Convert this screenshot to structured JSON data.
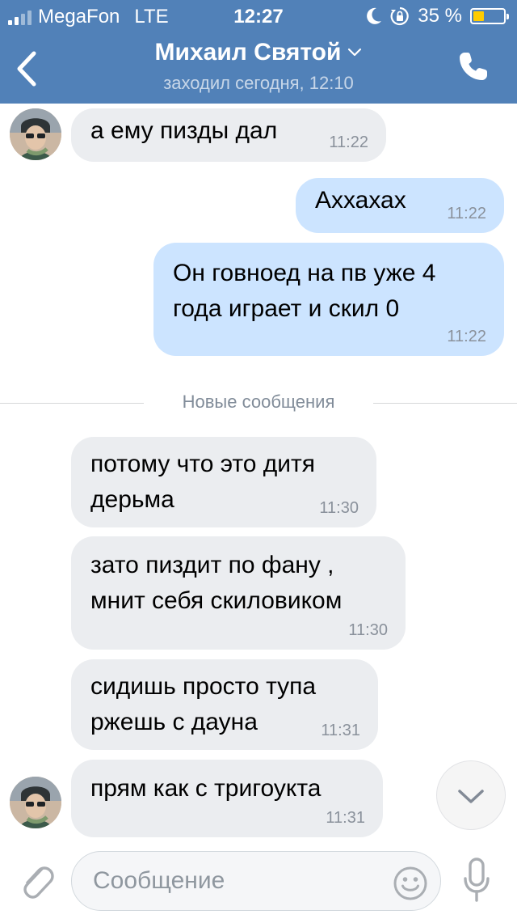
{
  "status_bar": {
    "carrier": "MegaFon",
    "network": "LTE",
    "time": "12:27",
    "battery_percent": "35 %",
    "battery_level": 0.35,
    "signal_bars": 2
  },
  "header": {
    "contact_name": "Михаил Святой",
    "last_seen": "заходил сегодня, 12:10"
  },
  "messages": [
    {
      "text": "а ему пизды дал",
      "time": "11:22",
      "direction": "in"
    },
    {
      "text": "Аххахах",
      "time": "11:22",
      "direction": "out"
    },
    {
      "text": "Он говноед на пв уже 4\nгода играет и скил 0",
      "time": "11:22",
      "direction": "out"
    },
    {
      "text": "потому что это дитя\nдерьма",
      "time": "11:30",
      "direction": "in"
    },
    {
      "text": "зато пиздит по фану ,\nмнит себя скиловиком",
      "time": "11:30",
      "direction": "in"
    },
    {
      "text": "сидишь просто тупа\nржешь с дауна",
      "time": "11:31",
      "direction": "in"
    },
    {
      "text": "прям как с тригоукта",
      "time": "11:31",
      "direction": "in"
    }
  ],
  "divider": {
    "label": "Новые сообщения"
  },
  "composer": {
    "placeholder": "Сообщение"
  },
  "colors": {
    "header_bg": "#5181b8",
    "incoming_bubble": "#ebedf0",
    "outgoing_bubble": "#cce4ff",
    "icon_blue": "#5181b8",
    "icon_gray": "#aaaeb3"
  },
  "icons": [
    "back-icon",
    "chevron-down-icon",
    "phone-icon",
    "moon-icon",
    "rotation-lock-icon",
    "attach-icon",
    "smile-icon",
    "microphone-icon",
    "scroll-down-icon"
  ]
}
